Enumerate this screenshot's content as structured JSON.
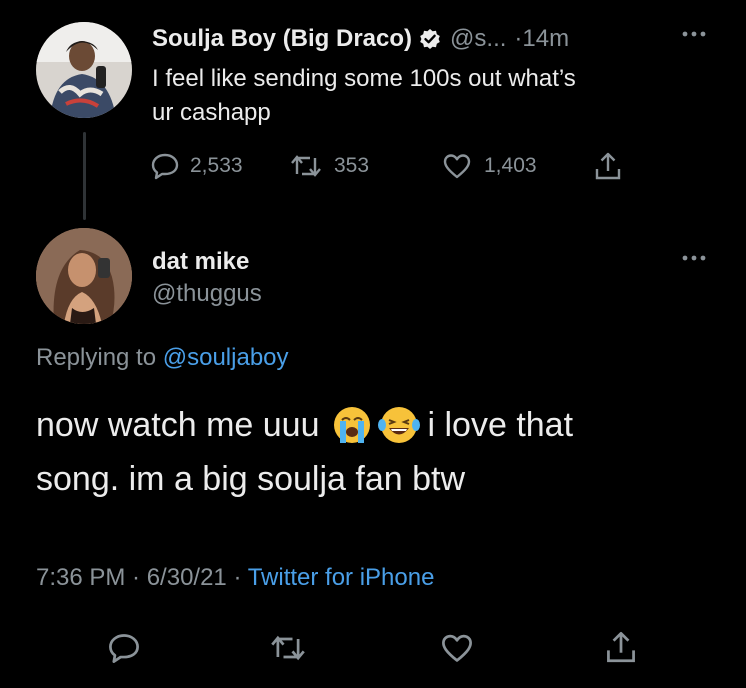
{
  "parent_tweet": {
    "display_name": "Soulja Boy (Big Draco)",
    "handle": "@s...",
    "time": "·14m",
    "text_line1": "I feel like sending some 100s out what’s",
    "text_line2": "ur cashapp",
    "replies": "2,533",
    "retweets": "353",
    "likes": "1,403"
  },
  "reply_tweet": {
    "display_name": "dat mike",
    "handle": "@thuggus",
    "replying_prefix": "Replying to",
    "replying_to": "@souljaboy",
    "text_line1_a": "now watch me uuu",
    "text_line1_b": "i love that",
    "text_line2": "song. im a big soulja fan btw",
    "timestamp": "7:36 PM · 6/30/21 ·",
    "source": "Twitter for iPhone"
  },
  "colors": {
    "background": "#000000",
    "accent_blue": "#4a9fe8",
    "muted": "#8b9399",
    "text": "#ececec"
  },
  "icons": [
    "verified-badge-icon",
    "more-icon",
    "reply-icon",
    "retweet-icon",
    "like-icon",
    "share-icon",
    "loudly-crying-emoji",
    "laughing-emoji"
  ]
}
